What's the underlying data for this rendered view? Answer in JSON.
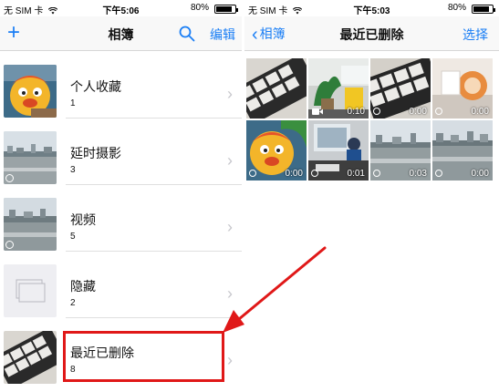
{
  "left_screen": {
    "status": {
      "carrier": "无 SIM 卡",
      "time": "下午5:06",
      "battery": "80%",
      "battery_level": 0.8
    },
    "nav": {
      "add_icon": "plus-icon",
      "title": "相簿",
      "search_icon": "search-icon",
      "edit": "编辑"
    },
    "albums": [
      {
        "name": "个人收藏",
        "count": "1"
      },
      {
        "name": "延时摄影",
        "count": "3"
      },
      {
        "name": "视频",
        "count": "5"
      },
      {
        "name": "隐藏",
        "count": "2"
      },
      {
        "name": "最近已删除",
        "count": "8"
      }
    ]
  },
  "right_screen": {
    "status": {
      "carrier": "无 SIM 卡",
      "time": "下午5:03",
      "battery": "80%",
      "battery_level": 0.8
    },
    "nav": {
      "back": "相簿",
      "title": "最近已删除",
      "select": "选择"
    },
    "tiles": [
      {
        "duration": ""
      },
      {
        "duration": "0:10"
      },
      {
        "duration": "0:00"
      },
      {
        "duration": "0:00"
      },
      {
        "duration": "0:00"
      },
      {
        "duration": "0:01"
      },
      {
        "duration": "0:03"
      },
      {
        "duration": "0:00"
      }
    ]
  },
  "colors": {
    "accent": "#1a7ef5",
    "highlight": "#e01818"
  }
}
